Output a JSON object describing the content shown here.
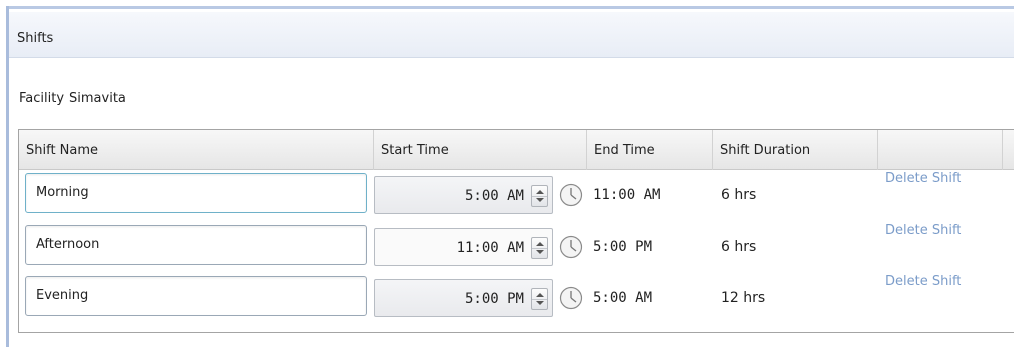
{
  "panel": {
    "title": "Shifts"
  },
  "facility": {
    "label": "Facility",
    "value": "Simavita"
  },
  "grid": {
    "columns": [
      "Shift Name",
      "Start Time",
      "End Time",
      "Shift Duration",
      ""
    ],
    "rows": [
      {
        "name": "Morning",
        "start_time": "5:00 AM",
        "end_time": "11:00 AM",
        "duration": "6 hrs",
        "action": "Delete Shift"
      },
      {
        "name": "Afternoon",
        "start_time": "11:00 AM",
        "end_time": "5:00 PM",
        "duration": "6 hrs",
        "action": "Delete Shift"
      },
      {
        "name": "Evening",
        "start_time": "5:00 PM",
        "end_time": "5:00 AM",
        "duration": "12 hrs",
        "action": "Delete Shift"
      }
    ]
  },
  "icons": {
    "time_picker": "clock-icon",
    "spinner": "spin-updown-icon"
  },
  "colors": {
    "link": "#7b9cc9",
    "accent": "#a9bcdc",
    "focus_border": "#6fb1c9"
  }
}
